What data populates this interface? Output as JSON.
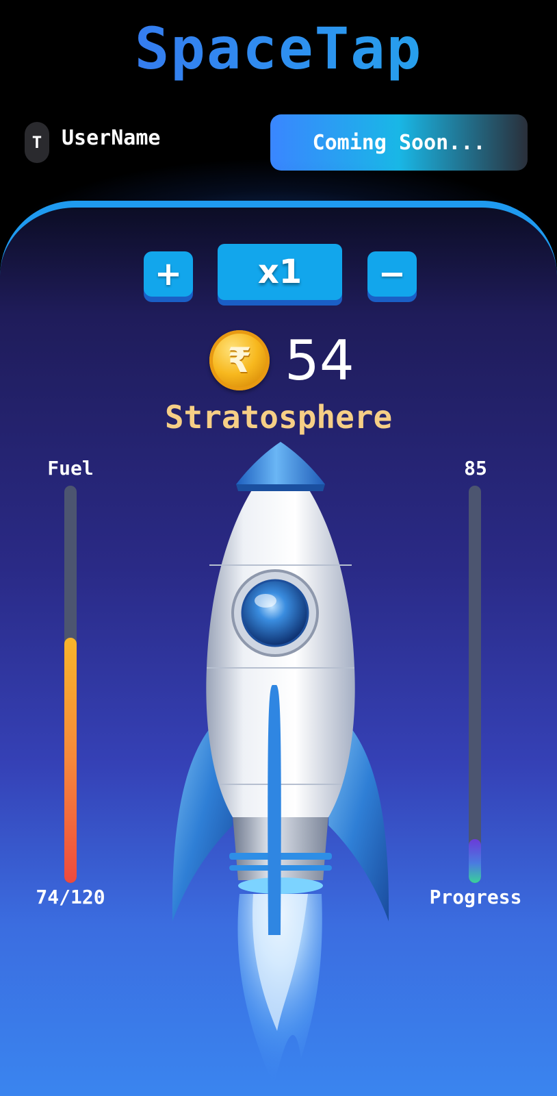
{
  "app": {
    "title": "SpaceTap"
  },
  "header": {
    "user_initial": "T",
    "user_name": "UserName",
    "coming_soon_label": "Coming Soon..."
  },
  "multiplier": {
    "plus_label": "+",
    "value": "x1",
    "minus_label": "−"
  },
  "balance": {
    "coin_symbol": "₹",
    "amount": "54"
  },
  "level": {
    "name": "Stratosphere"
  },
  "fuel": {
    "label": "Fuel",
    "current": 74,
    "max": 120,
    "display": "74/120",
    "fill_fraction": 0.6167
  },
  "progress": {
    "value": "85",
    "label": "Progress",
    "fill_fraction": 0.11
  },
  "icons": {
    "coin": "rupee-coin-icon",
    "rocket": "rocket-icon"
  },
  "colors": {
    "accent": "#12a6ec",
    "level_text": "#f6cf86",
    "panel_border": "#1f9af0"
  }
}
